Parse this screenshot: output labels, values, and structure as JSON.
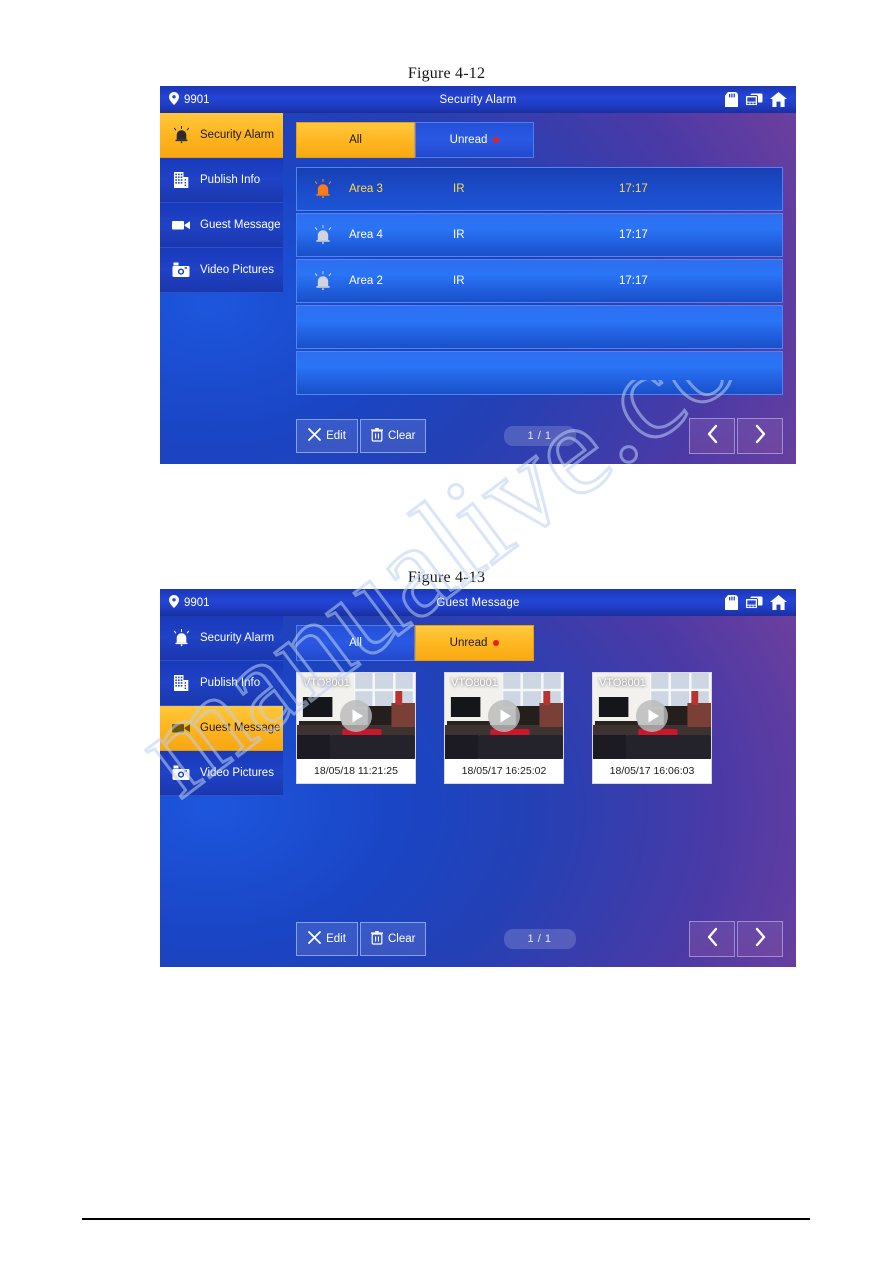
{
  "page": {
    "figure_1_caption": "Figure 4-12",
    "figure_2_caption": "Figure 4-13",
    "watermark_text": "manualive.com"
  },
  "colors": {
    "accent_gold": "#ffb621",
    "tab_blue": "#2a59e4",
    "header_blue": "#2344d6",
    "alert_red": "#f01b1b",
    "selected_text": "#ffd94a"
  },
  "figure_4_12": {
    "titlebar": {
      "room_number": "9901",
      "title": "Security Alarm",
      "pin_icon": "location-pin-icon",
      "icons": [
        "sd-card-icon",
        "unlock-device-icon",
        "home-icon"
      ]
    },
    "sidebar": [
      {
        "label": "Security Alarm",
        "icon": "bell-alarm-icon",
        "active": true
      },
      {
        "label": "Publish Info",
        "icon": "building-grid-icon",
        "active": false
      },
      {
        "label": "Guest Message",
        "icon": "video-camera-icon",
        "active": false
      },
      {
        "label": "Video Pictures",
        "icon": "photo-camera-icon",
        "active": false
      }
    ],
    "tabs": [
      {
        "label": "All",
        "active": true,
        "badge": false
      },
      {
        "label": "Unread",
        "active": false,
        "badge": true
      }
    ],
    "list_rows": [
      {
        "icon": "bell-alarm-icon",
        "area": "Area 3",
        "type": "IR",
        "time": "17:17",
        "selected": true
      },
      {
        "icon": "bell-alarm-icon",
        "area": "Area 4",
        "type": "IR",
        "time": "17:17",
        "selected": false
      },
      {
        "icon": "bell-alarm-icon",
        "area": "Area 2",
        "type": "IR",
        "time": "17:17",
        "selected": false
      },
      {
        "icon": "",
        "area": "",
        "type": "",
        "time": "",
        "selected": false
      },
      {
        "icon": "",
        "area": "",
        "type": "",
        "time": "",
        "selected": false
      }
    ],
    "toolbar": {
      "edit_label": "Edit",
      "edit_icon": "close-x-icon",
      "clear_label": "Clear",
      "clear_icon": "trash-icon",
      "pager": "1 / 1",
      "prev_icon": "chevron-left-icon",
      "next_icon": "chevron-right-icon"
    }
  },
  "figure_4_13": {
    "titlebar": {
      "room_number": "9901",
      "title": "Guest Message",
      "pin_icon": "location-pin-icon",
      "icons": [
        "sd-card-icon",
        "unlock-device-icon",
        "home-icon"
      ]
    },
    "sidebar": [
      {
        "label": "Security Alarm",
        "icon": "bell-alarm-icon",
        "active": false
      },
      {
        "label": "Publish Info",
        "icon": "building-grid-icon",
        "active": false
      },
      {
        "label": "Guest Message",
        "icon": "video-camera-icon",
        "active": true
      },
      {
        "label": "Video Pictures",
        "icon": "photo-camera-icon",
        "active": false
      }
    ],
    "tabs": [
      {
        "label": "All",
        "active": false,
        "badge": false
      },
      {
        "label": "Unread",
        "active": true,
        "badge": true
      }
    ],
    "thumbnails": [
      {
        "device": "VTO8001",
        "timestamp": "18/05/18 11:21:25",
        "play_icon": "play-circle-icon"
      },
      {
        "device": "VTO8001",
        "timestamp": "18/05/17 16:25:02",
        "play_icon": "play-circle-icon"
      },
      {
        "device": "VTO8001",
        "timestamp": "18/05/17 16:06:03",
        "play_icon": "play-circle-icon"
      }
    ],
    "toolbar": {
      "edit_label": "Edit",
      "edit_icon": "close-x-icon",
      "clear_label": "Clear",
      "clear_icon": "trash-icon",
      "pager": "1 / 1",
      "prev_icon": "chevron-left-icon",
      "next_icon": "chevron-right-icon"
    }
  }
}
